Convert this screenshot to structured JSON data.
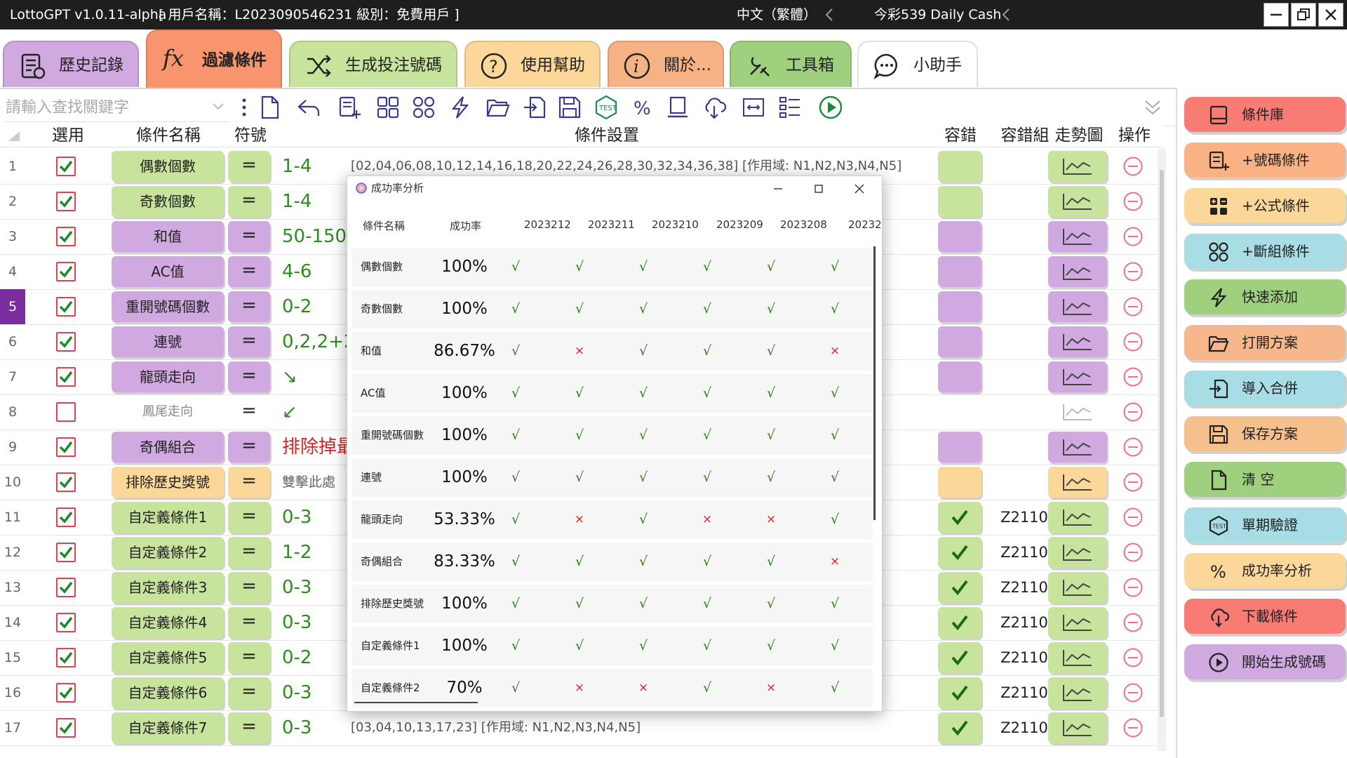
{
  "window": {
    "app_title": "LottoGPT v1.0.11-alpha",
    "user_info": "[ 用戶名稱：L2023090546231  級別：免費用戶 ]",
    "language": "中文（繁體）",
    "game": "今彩539 Daily Cash"
  },
  "tabs": [
    {
      "label": "歷史記錄",
      "icon": "history-list-icon",
      "color": "#cfa9e0"
    },
    {
      "label": "過濾條件",
      "icon": "fx-function-icon",
      "color": "#f8956e",
      "active": true
    },
    {
      "label": "生成投注號碼",
      "icon": "shuffle-icon",
      "color": "#c8e39c"
    },
    {
      "label": "使用幫助",
      "icon": "question-circle-icon",
      "color": "#fcd79a"
    },
    {
      "label": "關於...",
      "icon": "info-circle-icon",
      "color": "#f6b184"
    },
    {
      "label": "工具箱",
      "icon": "tools-icon",
      "color": "#9fd07e"
    },
    {
      "label": "小助手",
      "icon": "chat-bubble-icon",
      "color": "#ffffff"
    }
  ],
  "search": {
    "placeholder": "請輸入查找關鍵字"
  },
  "toolbar_icons": [
    "more-vertical-icon",
    "new-file-icon",
    "undo-icon",
    "add-number-condition-icon",
    "add-formula-icon",
    "add-group-icon",
    "quick-add-icon",
    "open-folder-icon",
    "import-icon",
    "save-icon",
    "test-icon",
    "percent-icon",
    "archive-icon",
    "cloud-download-icon",
    "resize-icon",
    "list-tree-icon",
    "play-circle-icon"
  ],
  "columns": {
    "select": "選用",
    "name": "條件名稱",
    "symbol": "符號",
    "settings": "條件設置",
    "tolerance": "容錯",
    "tolerance_group": "容錯組",
    "trend": "走勢圖",
    "action": "操作"
  },
  "rows": [
    {
      "num": "1",
      "checked": true,
      "name": "偶數個數",
      "sym": "=",
      "value": "1-4",
      "desc": "[02,04,06,08,10,12,14,16,18,20,22,24,26,28,30,32,34,36,38] [作用域:   N1,N2,N3,N4,N5]",
      "color": "green",
      "tol": false,
      "grp": ""
    },
    {
      "num": "2",
      "checked": true,
      "name": "奇數個數",
      "sym": "=",
      "value": "1-4",
      "desc": "",
      "color": "green",
      "tol": false,
      "grp": ""
    },
    {
      "num": "3",
      "checked": true,
      "name": "和值",
      "sym": "=",
      "value": "50-150",
      "desc": "",
      "color": "purple",
      "tol": false,
      "grp": ""
    },
    {
      "num": "4",
      "checked": true,
      "name": "AC值",
      "sym": "=",
      "value": "4-6",
      "desc": "",
      "color": "purple",
      "tol": false,
      "grp": ""
    },
    {
      "num": "5",
      "checked": true,
      "name": "重開號碼個數",
      "sym": "=",
      "value": "0-2",
      "desc": "",
      "color": "purple",
      "tol": false,
      "grp": "",
      "selected": true
    },
    {
      "num": "6",
      "checked": true,
      "name": "連號",
      "sym": "=",
      "value": "0,2,2+2",
      "desc": "",
      "color": "purple",
      "tol": false,
      "grp": ""
    },
    {
      "num": "7",
      "checked": true,
      "name": "龍頭走向",
      "sym": "=",
      "value": "↘",
      "desc": "",
      "color": "purple",
      "tol": false,
      "grp": ""
    },
    {
      "num": "8",
      "checked": false,
      "name": "鳳尾走向",
      "sym": "=",
      "value": "↙",
      "desc": "",
      "color": "none",
      "tol": false,
      "grp": "",
      "disabled": true
    },
    {
      "num": "9",
      "checked": true,
      "name": "奇偶組合",
      "sym": "=",
      "value": "排除掉最",
      "desc": "",
      "color": "purple",
      "tol": false,
      "grp": "",
      "value_color": "#e02020"
    },
    {
      "num": "10",
      "checked": true,
      "name": "排除歷史獎號",
      "sym": "=",
      "value": "雙擊此處",
      "desc": "",
      "color": "orange",
      "tol": false,
      "grp": "",
      "value_color": "#666666"
    },
    {
      "num": "11",
      "checked": true,
      "name": "自定義條件1",
      "sym": "=",
      "value": "0-3",
      "desc": "",
      "color": "green",
      "tol": true,
      "grp": "Z2110"
    },
    {
      "num": "12",
      "checked": true,
      "name": "自定義條件2",
      "sym": "=",
      "value": "1-2",
      "desc": "",
      "color": "green",
      "tol": true,
      "grp": "Z2110"
    },
    {
      "num": "13",
      "checked": true,
      "name": "自定義條件3",
      "sym": "=",
      "value": "0-3",
      "desc": "",
      "color": "green",
      "tol": true,
      "grp": "Z2110"
    },
    {
      "num": "14",
      "checked": true,
      "name": "自定義條件4",
      "sym": "=",
      "value": "0-3",
      "desc": "",
      "color": "green",
      "tol": true,
      "grp": "Z2110"
    },
    {
      "num": "15",
      "checked": true,
      "name": "自定義條件5",
      "sym": "=",
      "value": "0-2",
      "desc": "",
      "color": "green",
      "tol": true,
      "grp": "Z2110"
    },
    {
      "num": "16",
      "checked": true,
      "name": "自定義條件6",
      "sym": "=",
      "value": "0-3",
      "desc": "",
      "color": "green",
      "tol": true,
      "grp": "Z2110"
    },
    {
      "num": "17",
      "checked": true,
      "name": "自定義條件7",
      "sym": "=",
      "value": "0-3",
      "desc": "[03,04,10,13,17,23] [作用域:   N1,N2,N3,N4,N5]",
      "color": "green",
      "tol": true,
      "grp": "Z2110"
    }
  ],
  "right_panel": [
    {
      "label": "條件庫",
      "icon": "library-icon",
      "color": "#f87b74"
    },
    {
      "label": "+號碼條件",
      "icon": "add-number-condition-icon",
      "color": "#fab183"
    },
    {
      "label": "+公式條件",
      "icon": "add-formula-icon",
      "color": "#fcd79a"
    },
    {
      "label": "+斷組條件",
      "icon": "add-group-icon",
      "color": "#a9dde6"
    },
    {
      "label": "快速添加",
      "icon": "quick-add-icon",
      "color": "#9fd07e"
    },
    {
      "label": "打開方案",
      "icon": "open-folder-icon",
      "color": "#f6b78c"
    },
    {
      "label": "導入合併",
      "icon": "import-icon",
      "color": "#a9dde6"
    },
    {
      "label": "保存方案",
      "icon": "save-icon",
      "color": "#f6c08c"
    },
    {
      "label": "清 空",
      "icon": "new-file-icon",
      "color": "#9fd07e"
    },
    {
      "label": "單期驗證",
      "icon": "test-icon",
      "color": "#a9dde6"
    },
    {
      "label": "成功率分析",
      "icon": "percent-icon",
      "color": "#fcd79a"
    },
    {
      "label": "下載條件",
      "icon": "cloud-download-icon",
      "color": "#f87b74"
    },
    {
      "label": "開始生成號碼",
      "icon": "play-circle-icon",
      "color": "#cfa9e0"
    }
  ],
  "dialog": {
    "title": "成功率分析",
    "headers": [
      "條件名稱",
      "成功率",
      "2023212",
      "2023211",
      "2023210",
      "2023209",
      "2023208",
      "20232"
    ],
    "rows": [
      {
        "name": "偶數個數",
        "rate": "100%",
        "marks": [
          "√",
          "√",
          "√",
          "√",
          "√",
          "√"
        ]
      },
      {
        "name": "奇數個數",
        "rate": "100%",
        "marks": [
          "√",
          "√",
          "√",
          "√",
          "√",
          "√"
        ]
      },
      {
        "name": "和值",
        "rate": "86.67%",
        "marks": [
          "√",
          "×",
          "√",
          "√",
          "√",
          "×"
        ]
      },
      {
        "name": "AC值",
        "rate": "100%",
        "marks": [
          "√",
          "√",
          "√",
          "√",
          "√",
          "√"
        ]
      },
      {
        "name": "重開號碼個數",
        "rate": "100%",
        "marks": [
          "√",
          "√",
          "√",
          "√",
          "√",
          "√"
        ]
      },
      {
        "name": "連號",
        "rate": "100%",
        "marks": [
          "√",
          "√",
          "√",
          "√",
          "√",
          "√"
        ]
      },
      {
        "name": "龍頭走向",
        "rate": "53.33%",
        "marks": [
          "√",
          "×",
          "√",
          "×",
          "×",
          "√"
        ]
      },
      {
        "name": "奇偶組合",
        "rate": "83.33%",
        "marks": [
          "√",
          "√",
          "√",
          "√",
          "√",
          "×"
        ]
      },
      {
        "name": "排除歷史獎號",
        "rate": "100%",
        "marks": [
          "√",
          "√",
          "√",
          "√",
          "√",
          "√"
        ]
      },
      {
        "name": "自定義條件1",
        "rate": "100%",
        "marks": [
          "√",
          "√",
          "√",
          "√",
          "√",
          "√"
        ]
      },
      {
        "name": "自定義條件2",
        "rate": "70%",
        "marks": [
          "√",
          "×",
          "×",
          "√",
          "×",
          "√"
        ]
      }
    ]
  }
}
